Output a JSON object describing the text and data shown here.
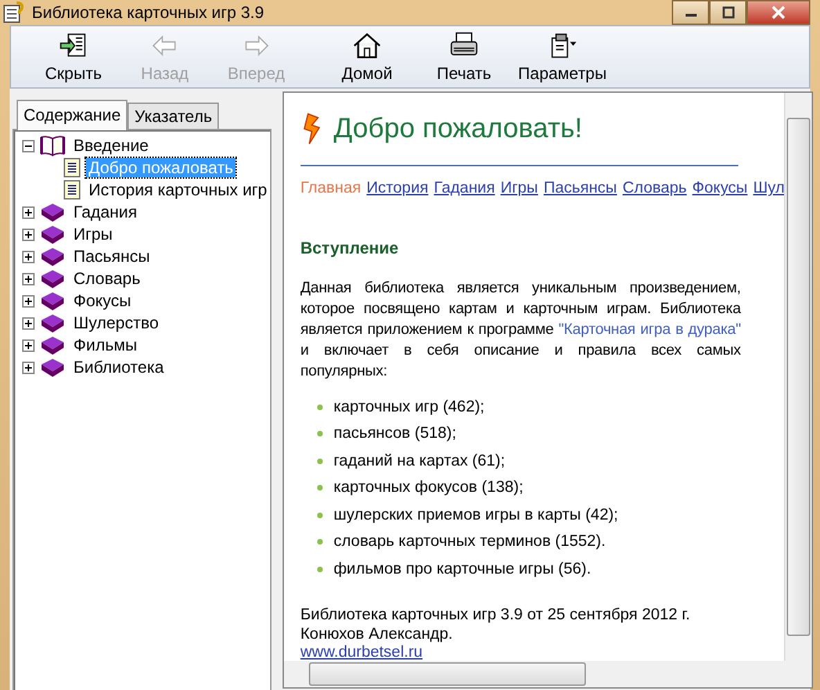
{
  "window": {
    "title": "Библиотека карточных игр 3.9"
  },
  "toolbar": [
    {
      "kind": "hide",
      "label": "Скрыть",
      "disabled": false
    },
    {
      "kind": "back",
      "label": "Назад",
      "disabled": true
    },
    {
      "kind": "forward",
      "label": "Вперед",
      "disabled": true
    },
    {
      "kind": "home",
      "label": "Домой",
      "disabled": false
    },
    {
      "kind": "print",
      "label": "Печать",
      "disabled": false
    },
    {
      "kind": "options",
      "label": "Параметры",
      "disabled": false
    }
  ],
  "tabs": [
    {
      "label": "Содержание",
      "selected": true
    },
    {
      "label": "Указатель",
      "selected": false
    }
  ],
  "tree": [
    {
      "label": "Введение",
      "expanded": true,
      "selected": false,
      "children": [
        {
          "label": "Добро пожаловать",
          "selected": true
        },
        {
          "label": "История карточных игр",
          "selected": false
        }
      ]
    },
    {
      "label": "Гадания",
      "expanded": false,
      "selected": false
    },
    {
      "label": "Игры",
      "expanded": false,
      "selected": false
    },
    {
      "label": "Пасьянсы",
      "expanded": false,
      "selected": false
    },
    {
      "label": "Словарь",
      "expanded": false,
      "selected": false
    },
    {
      "label": "Фокусы",
      "expanded": false,
      "selected": false
    },
    {
      "label": "Шулерство",
      "expanded": false,
      "selected": false
    },
    {
      "label": "Фильмы",
      "expanded": false,
      "selected": false
    },
    {
      "label": "Библиотека",
      "expanded": false,
      "selected": false
    }
  ],
  "page": {
    "heading": "Добро пожаловать!",
    "nav": [
      {
        "label": "Главная",
        "selected": true
      },
      {
        "label": "История",
        "selected": false
      },
      {
        "label": "Гадания",
        "selected": false
      },
      {
        "label": "Игры",
        "selected": false
      },
      {
        "label": "Пасьянсы",
        "selected": false
      },
      {
        "label": "Словарь",
        "selected": false
      },
      {
        "label": "Фокусы",
        "selected": false
      },
      {
        "label": "Шул",
        "selected": false
      }
    ],
    "section": "Вступление",
    "intro_before": "Данная библиотека является уникальным произведением, которое посвящено картам и карточным играм. Библиотека является приложением к программе",
    "intro_link": "\"Карточная игра в дурака\"",
    "intro_after": "и включает в себя описание и правила всех самых популярных:",
    "list": [
      "карточных игр (462);",
      "пасьянсов (518);",
      "гаданий на картах (61);",
      "карточных фокусов (138);",
      "шулерских приемов игры в карты (42);",
      "словарь карточных терминов (1552).",
      "фильмов про карточные игры (56)."
    ],
    "footer": [
      "Библиотека карточных игр 3.9 от 25 сентября 2012 г.",
      "Конюхов Александр."
    ],
    "site": "www.durbetsel.ru"
  }
}
